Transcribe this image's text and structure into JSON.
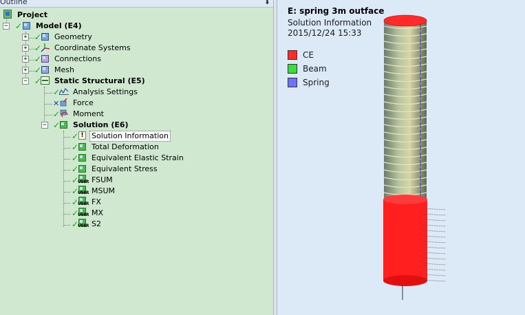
{
  "outline": {
    "title": "Outline",
    "tree": {
      "project": "Project",
      "model": "Model (E4)",
      "geometry": "Geometry",
      "coordinate_systems": "Coordinate Systems",
      "connections": "Connections",
      "mesh": "Mesh",
      "static_structural": "Static Structural (E5)",
      "analysis_settings": "Analysis Settings",
      "force": "Force",
      "moment": "Moment",
      "solution": "Solution (E6)",
      "solution_information": "Solution Information",
      "total_deformation": "Total Deformation",
      "equivalent_elastic_strain": "Equivalent Elastic Strain",
      "equivalent_stress": "Equivalent Stress",
      "user_results": [
        "FSUM",
        "MSUM",
        "FX",
        "MX",
        "S2"
      ],
      "user_badge": "USER"
    }
  },
  "viewport": {
    "title": "E: spring 3m outface",
    "subtitle": "Solution Information",
    "timestamp": "2015/12/24 15:33",
    "legend": [
      {
        "label": "CE",
        "color": "#ff2a2a"
      },
      {
        "label": "Beam",
        "color": "#3cdc3c"
      },
      {
        "label": "Spring",
        "color": "#7070ff"
      }
    ]
  }
}
